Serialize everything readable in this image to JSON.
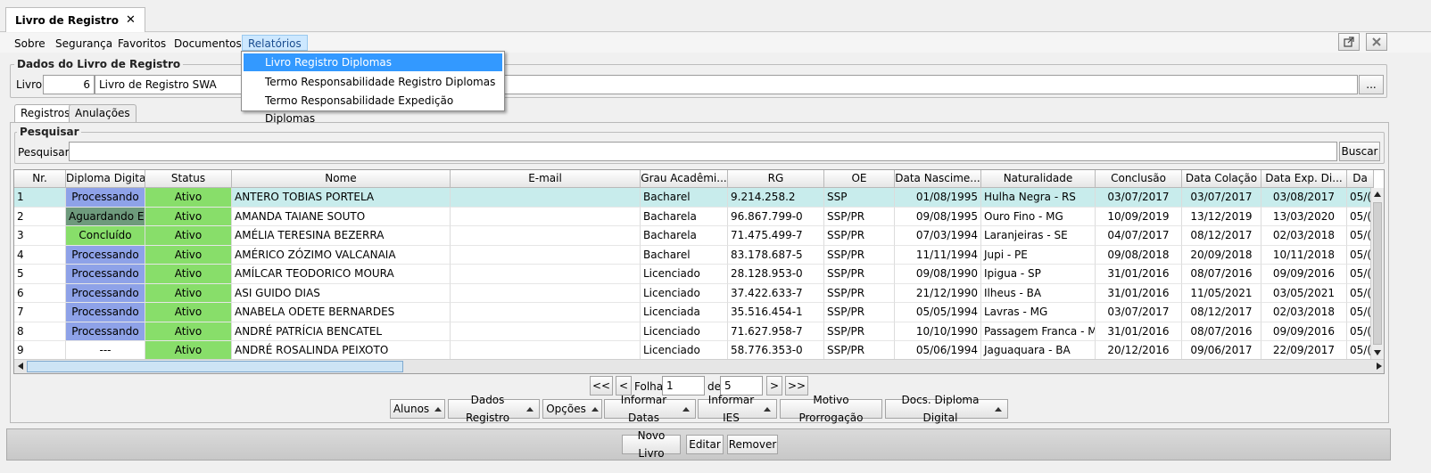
{
  "tab": {
    "title": "Livro de Registro",
    "close": "✕"
  },
  "menu": {
    "sobre": "Sobre",
    "seguranca": "Segurança",
    "favoritos": "Favoritos",
    "documentos": "Documentos",
    "relatorios": "Relatórios"
  },
  "dropdown": [
    "Livro Registro Diplomas",
    "Termo Responsabilidade Registro Diplomas",
    "Termo Responsabilidade Expedição Diplomas"
  ],
  "dados": {
    "legend": "Dados do Livro de Registro",
    "livro_label": "Livro:",
    "livro_num": "6",
    "livro_nome": "Livro de Registro SWA",
    "browse": "..."
  },
  "tabs": [
    "Registros",
    "Anulações"
  ],
  "pesquisar": {
    "legend": "Pesquisar",
    "label": "Pesquisar:",
    "value": "",
    "button": "Buscar"
  },
  "table": {
    "columns": [
      "Nr.",
      "Diploma Digital",
      "Status",
      "Nome",
      "E-mail",
      "Grau Acadêmi...",
      "RG",
      "OE",
      "Data Nascime...",
      "Naturalidade",
      "Conclusão",
      "Data Colação",
      "Data Exp. Di...",
      "Da"
    ],
    "rows": [
      [
        "1",
        "Processando",
        "Ativo",
        "ANTERO TOBIAS PORTELA",
        "",
        "Bacharel",
        "9.214.258.2",
        "SSP",
        "01/08/1995",
        "Hulha Negra - RS",
        "03/07/2017",
        "03/07/2017",
        "03/08/2017",
        "05/("
      ],
      [
        "2",
        "Aguardando E...",
        "Ativo",
        "AMANDA TAIANE SOUTO",
        "",
        "Bacharela",
        "96.867.799-0",
        "SSP/PR",
        "09/08/1995",
        "Ouro Fino - MG",
        "10/09/2019",
        "13/12/2019",
        "13/03/2020",
        "05/("
      ],
      [
        "3",
        "Concluído",
        "Ativo",
        "AMÉLIA TERESINA BEZERRA",
        "",
        "Bacharela",
        "71.475.499-7",
        "SSP/PR",
        "07/03/1994",
        "Laranjeiras - SE",
        "04/07/2017",
        "08/12/2017",
        "02/03/2018",
        "05/("
      ],
      [
        "4",
        "Processando",
        "Ativo",
        "AMÉRICO ZÓZIMO VALCANAIA",
        "",
        "Bacharel",
        "83.178.687-5",
        "SSP/PR",
        "11/11/1994",
        "Jupi - PE",
        "09/08/2018",
        "20/09/2018",
        "10/11/2018",
        "05/("
      ],
      [
        "5",
        "Processando",
        "Ativo",
        "AMÍLCAR TEODORICO MOURA",
        "",
        "Licenciado",
        "28.128.953-0",
        "SSP/PR",
        "09/08/1990",
        "Ipigua - SP",
        "31/01/2016",
        "08/07/2016",
        "09/09/2016",
        "05/("
      ],
      [
        "6",
        "Processando",
        "Ativo",
        "ASI GUIDO DIAS",
        "",
        "Licenciado",
        "37.422.633-7",
        "SSP/PR",
        "21/12/1990",
        "Ilheus - BA",
        "31/01/2016",
        "11/05/2021",
        "03/05/2021",
        "05/("
      ],
      [
        "7",
        "Processando",
        "Ativo",
        "ANABELA ODETE BERNARDES",
        "",
        "Licenciada",
        "35.516.454-1",
        "SSP/PR",
        "05/05/1994",
        "Lavras - MG",
        "03/07/2017",
        "08/12/2017",
        "02/03/2018",
        "05/("
      ],
      [
        "8",
        "Processando",
        "Ativo",
        "ANDRÉ PATRÍCIA BENCATEL",
        "",
        "Licenciado",
        "71.627.958-7",
        "SSP/PR",
        "10/10/1990",
        "Passagem Franca - MA",
        "31/01/2016",
        "08/07/2016",
        "09/09/2016",
        "05/("
      ],
      [
        "9",
        "---",
        "Ativo",
        "ANDRÉ ROSALINDA PEIXOTO",
        "",
        "Licenciado",
        "58.776.353-0",
        "SSP/PR",
        "05/06/1994",
        "Jaguaquara - BA",
        "20/12/2016",
        "09/06/2017",
        "22/09/2017",
        "05/("
      ]
    ]
  },
  "pager": {
    "first": "<<",
    "prev": "<",
    "folha": "Folha",
    "page": "1",
    "de": "de",
    "total": "5",
    "next": ">",
    "last": ">>"
  },
  "actions": [
    "Alunos",
    "Dados Registro",
    "Opções",
    "Informar Datas",
    "Informar IES",
    "Motivo Prorrogação",
    "Docs. Diploma Digital"
  ],
  "bottom": [
    "Novo Livro",
    "Editar",
    "Remover"
  ]
}
